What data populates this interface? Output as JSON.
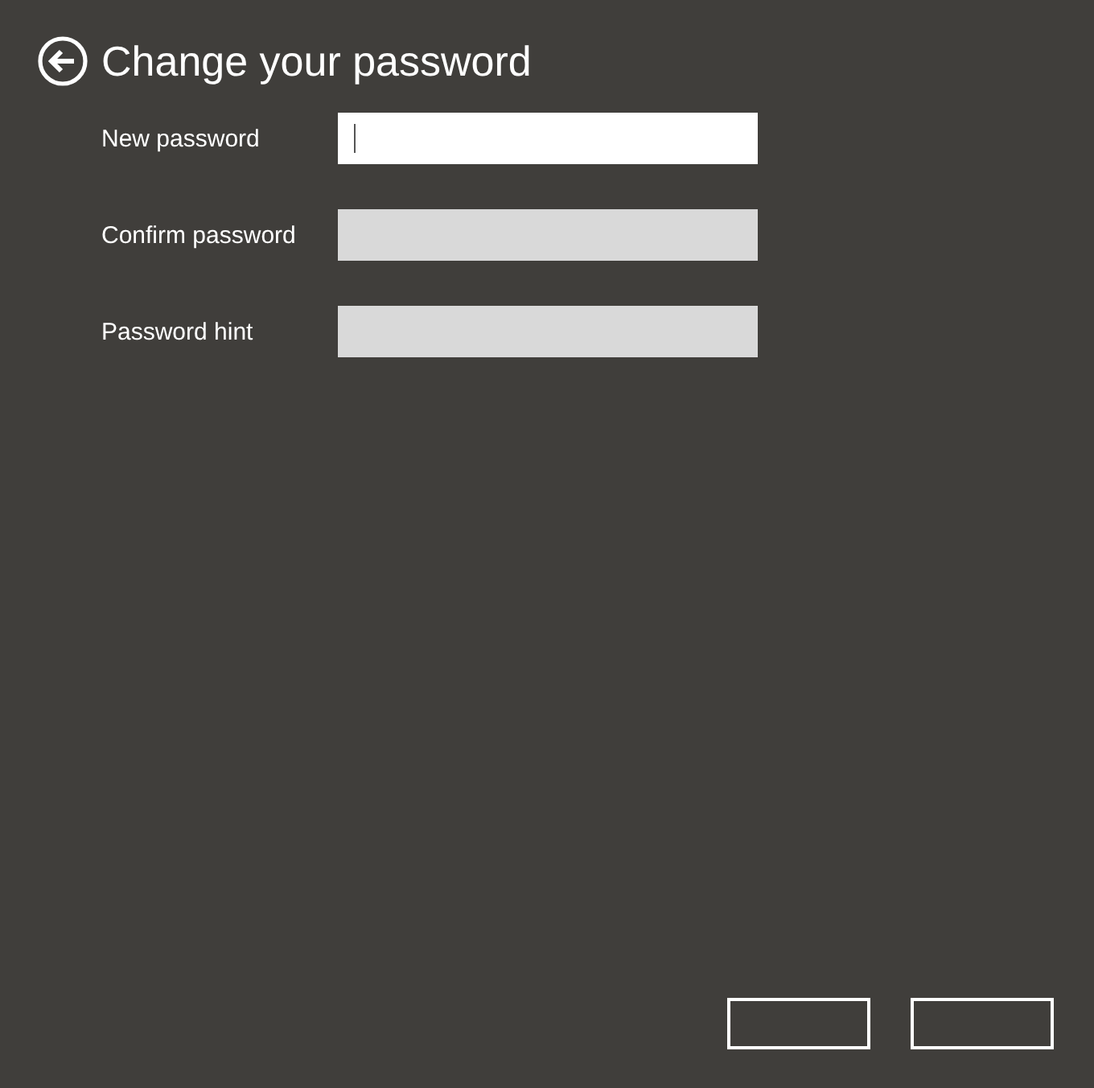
{
  "page": {
    "title": "Change your password"
  },
  "fields": [
    {
      "label": "New password",
      "focused": true
    },
    {
      "label": "Confirm password",
      "focused": false
    },
    {
      "label": "Password hint",
      "focused": false
    }
  ],
  "buttons": [
    {
      "kind": "outlined"
    },
    {
      "kind": "outlined"
    }
  ]
}
